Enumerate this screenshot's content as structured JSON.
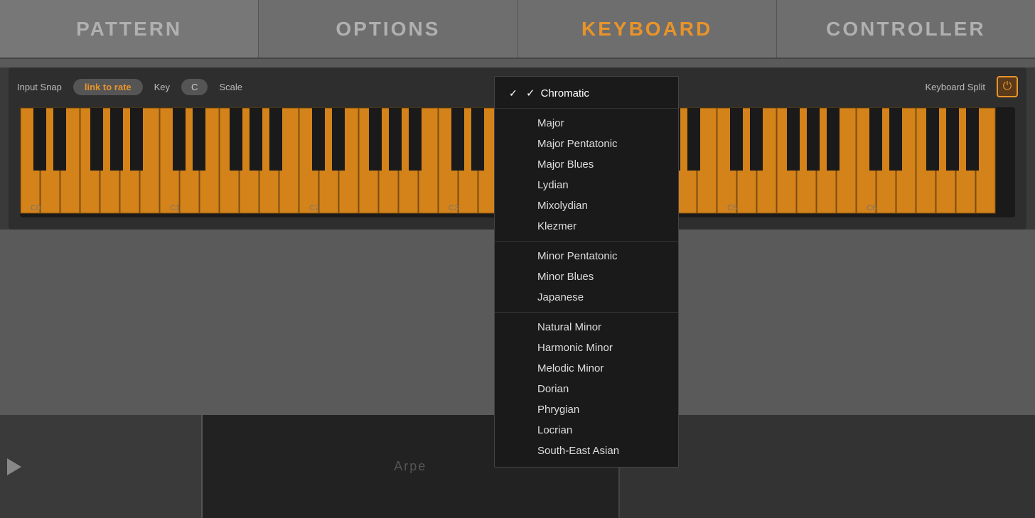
{
  "nav": {
    "tabs": [
      {
        "id": "pattern",
        "label": "PATTERN",
        "active": false
      },
      {
        "id": "options",
        "label": "OPTIONS",
        "active": false
      },
      {
        "id": "keyboard",
        "label": "KEYBOARD",
        "active": true
      },
      {
        "id": "controller",
        "label": "CONTROLLER",
        "active": false
      }
    ]
  },
  "keyboard_panel": {
    "input_snap_label": "Input Snap",
    "input_snap_value": "link to rate",
    "key_label": "Key",
    "key_value": "C",
    "scale_label": "Scale",
    "keyboard_split_label": "Keyboard Split"
  },
  "octave_labels": [
    "C0",
    "C1",
    "C2",
    "C3",
    "C5",
    "C6"
  ],
  "scale_dropdown": {
    "items": [
      {
        "id": "chromatic",
        "label": "Chromatic",
        "selected": true,
        "group": 0
      },
      {
        "id": "major",
        "label": "Major",
        "selected": false,
        "group": 1
      },
      {
        "id": "major-pentatonic",
        "label": "Major Pentatonic",
        "selected": false,
        "group": 1
      },
      {
        "id": "major-blues",
        "label": "Major Blues",
        "selected": false,
        "group": 1
      },
      {
        "id": "lydian",
        "label": "Lydian",
        "selected": false,
        "group": 1
      },
      {
        "id": "mixolydian",
        "label": "Mixolydian",
        "selected": false,
        "group": 1
      },
      {
        "id": "klezmer",
        "label": "Klezmer",
        "selected": false,
        "group": 1
      },
      {
        "id": "minor-pentatonic",
        "label": "Minor Pentatonic",
        "selected": false,
        "group": 2
      },
      {
        "id": "minor-blues",
        "label": "Minor Blues",
        "selected": false,
        "group": 2
      },
      {
        "id": "japanese",
        "label": "Japanese",
        "selected": false,
        "group": 2
      },
      {
        "id": "natural-minor",
        "label": "Natural Minor",
        "selected": false,
        "group": 3
      },
      {
        "id": "harmonic-minor",
        "label": "Harmonic Minor",
        "selected": false,
        "group": 3
      },
      {
        "id": "melodic-minor",
        "label": "Melodic Minor",
        "selected": false,
        "group": 3
      },
      {
        "id": "dorian",
        "label": "Dorian",
        "selected": false,
        "group": 3
      },
      {
        "id": "phrygian",
        "label": "Phrygian",
        "selected": false,
        "group": 3
      },
      {
        "id": "locrian",
        "label": "Locrian",
        "selected": false,
        "group": 3
      },
      {
        "id": "south-east-asian",
        "label": "South-East Asian",
        "selected": false,
        "group": 3
      }
    ]
  },
  "bottom": {
    "arpeggio_label": "Arpe",
    "play_tooltip": "Play"
  },
  "colors": {
    "accent": "#e8942a",
    "bg_dark": "#1a1a1a",
    "bg_mid": "#2e2e2e",
    "bg_light": "#3a3a3a",
    "tab_active_text": "#e8942a",
    "tab_inactive_text": "#b0b0b0",
    "key_white": "#d4821a",
    "key_black": "#1a1a1a"
  }
}
